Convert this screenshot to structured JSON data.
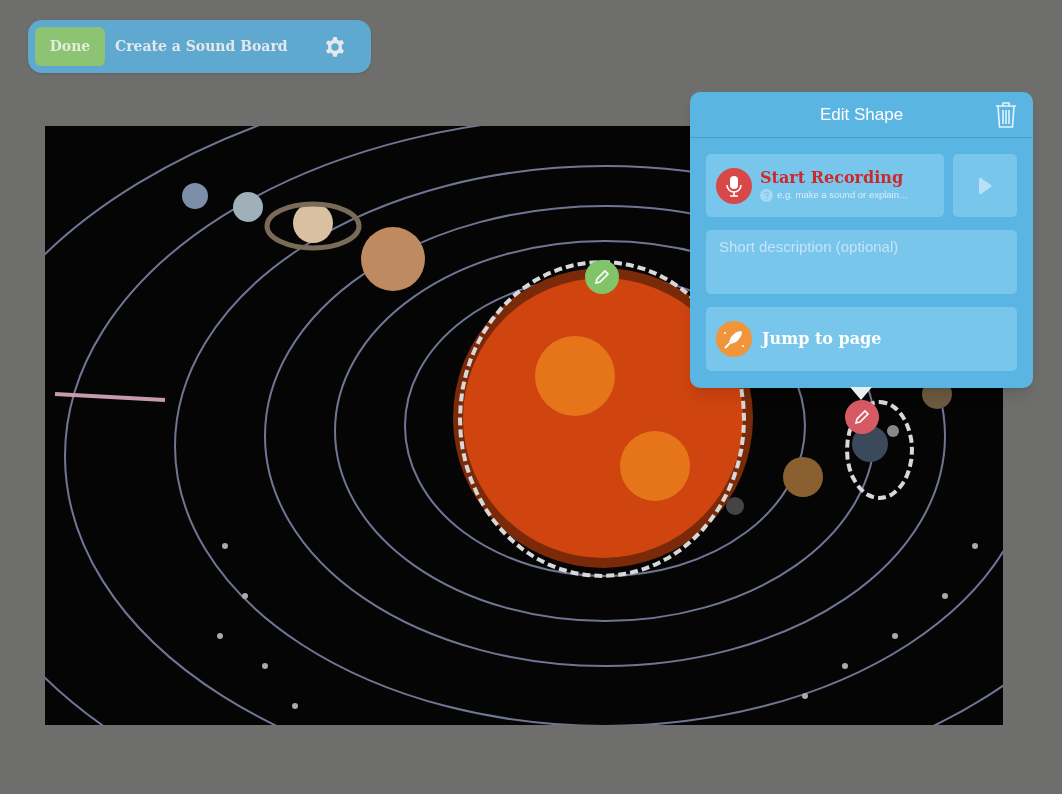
{
  "toolbar": {
    "done_button": "Done",
    "title": "Create a Sound Board"
  },
  "shapes": [
    {
      "selected": false
    },
    {
      "selected": true
    }
  ],
  "edit_shape_panel": {
    "title": "Edit Shape",
    "record": {
      "label": "Start Recording",
      "hint": "e.g. make a sound or explain…"
    },
    "description": {
      "placeholder": "Short description (optional)"
    },
    "jump_button": "Jump to page"
  }
}
